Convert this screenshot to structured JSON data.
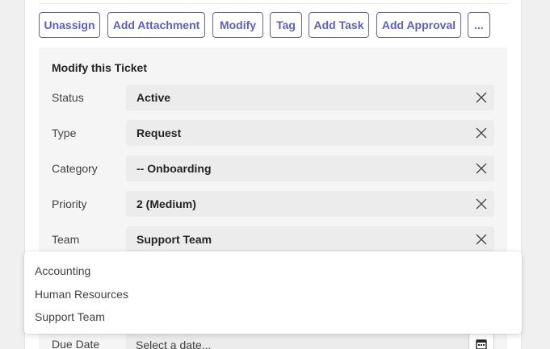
{
  "actions": [
    {
      "id": "unassign",
      "label": "Unassign"
    },
    {
      "id": "add-attachment",
      "label": "Add Attachment"
    },
    {
      "id": "modify",
      "label": "Modify"
    },
    {
      "id": "tag",
      "label": "Tag"
    },
    {
      "id": "add-task",
      "label": "Add Task"
    },
    {
      "id": "add-approval",
      "label": "Add Approval"
    },
    {
      "id": "more",
      "label": "..."
    }
  ],
  "form": {
    "title": "Modify this Ticket",
    "fields": [
      {
        "label": "Status",
        "value": "Active"
      },
      {
        "label": "Type",
        "value": "Request"
      },
      {
        "label": "Category",
        "value": "-- Onboarding"
      },
      {
        "label": "Priority",
        "value": "2 (Medium)"
      },
      {
        "label": "Team",
        "value": "Support Team"
      }
    ],
    "due_date": {
      "label": "Due Date",
      "placeholder": "Select a date..."
    }
  },
  "team_dropdown": {
    "options": [
      "Accounting",
      "Human Resources",
      "Support Team"
    ]
  },
  "icons": {
    "clear": "close-icon",
    "calendar": "calendar-icon"
  },
  "colors": {
    "accent": "#5b5fc7",
    "accent_border": "#6264a7"
  }
}
